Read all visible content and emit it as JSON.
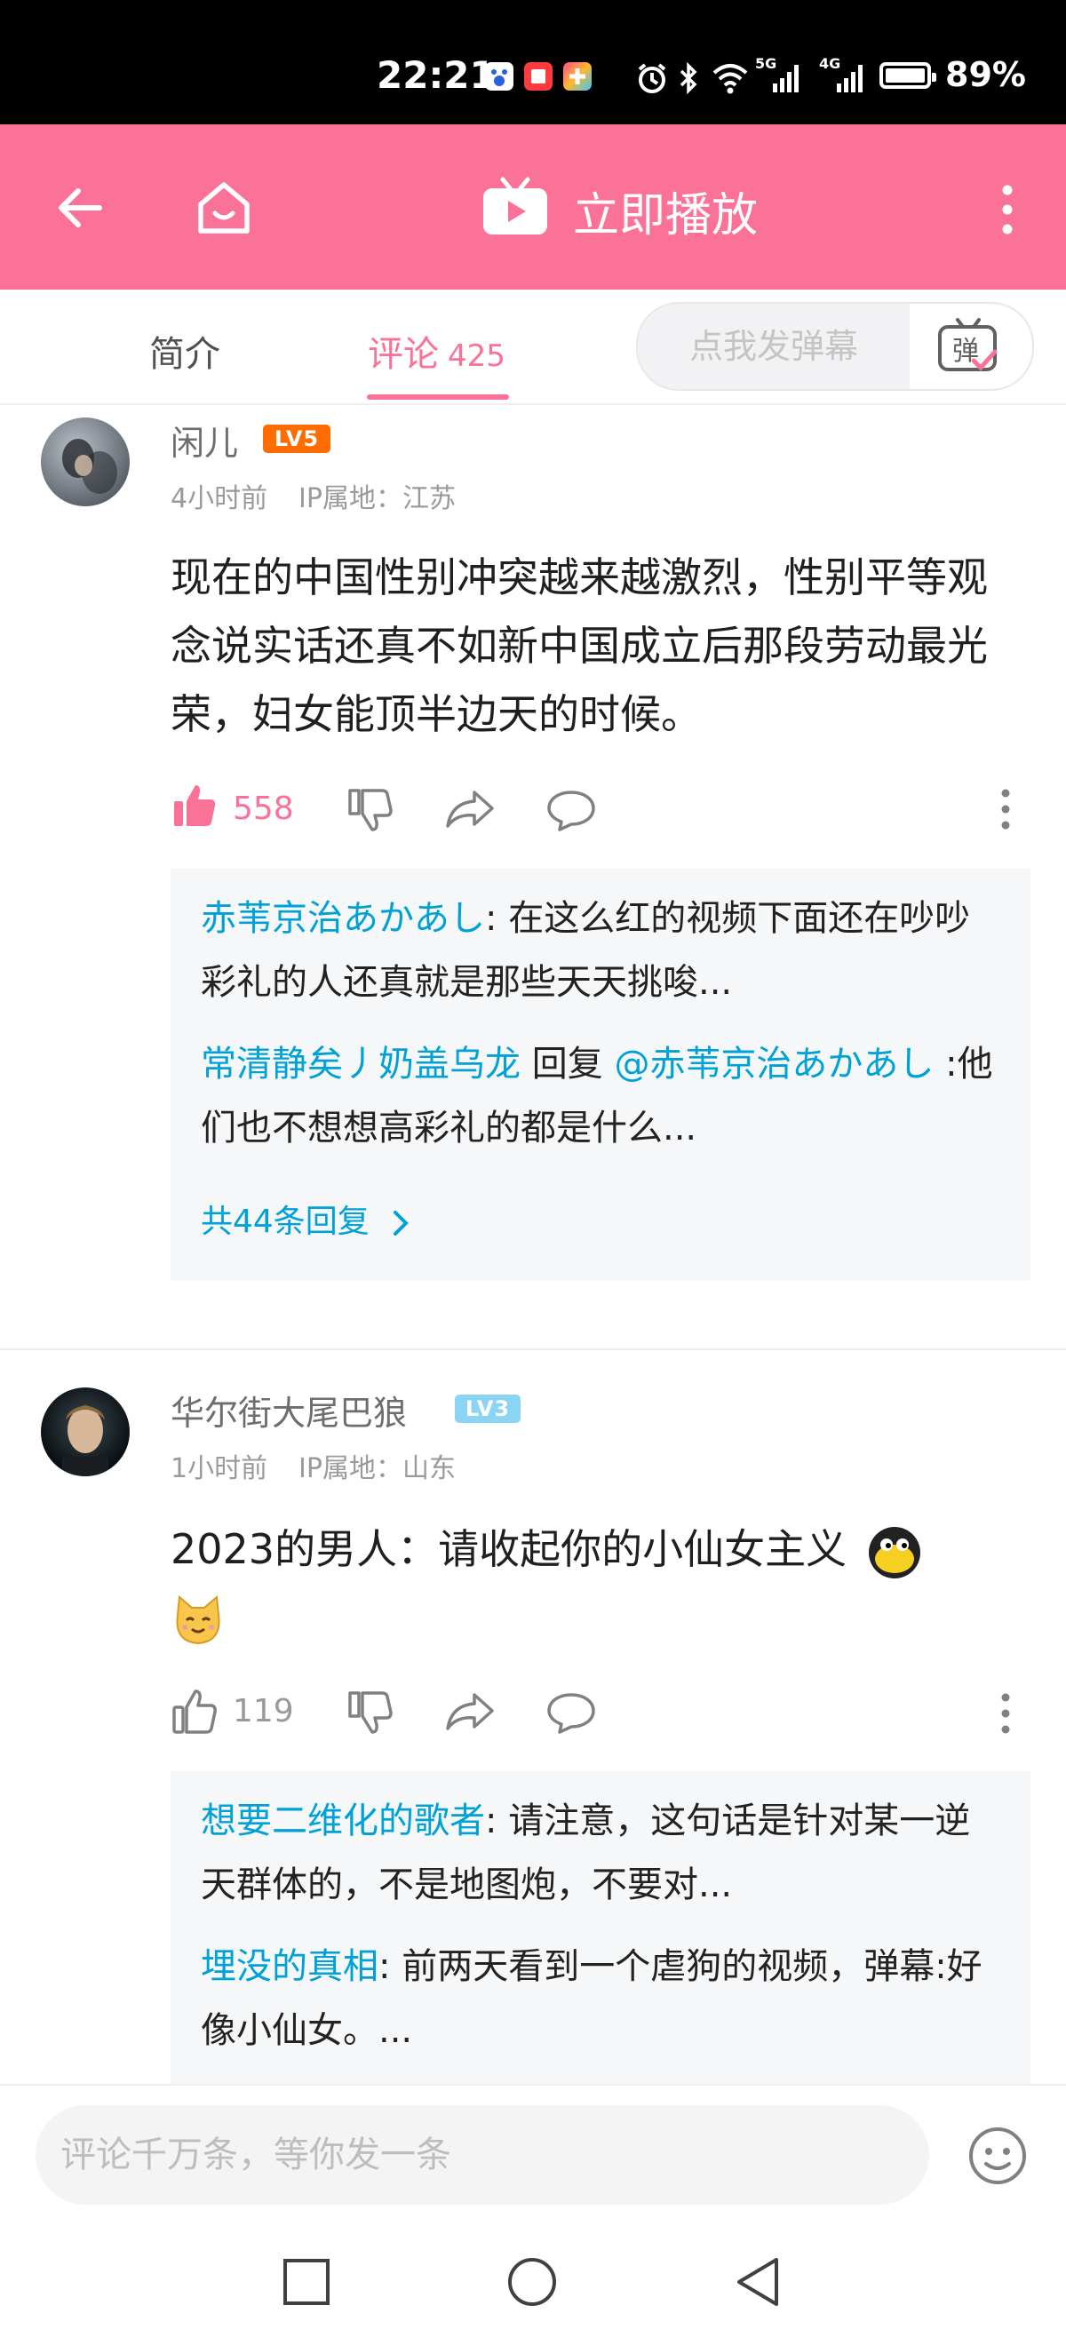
{
  "status_bar": {
    "time": "22:21",
    "battery": "89%",
    "network_1": "5G",
    "network_2": "4G"
  },
  "toolbar": {
    "play_label": "立即播放"
  },
  "tabs": {
    "intro": "简介",
    "comments": "评论",
    "comment_count": "425",
    "danmaku_placeholder": "点我发弹幕",
    "danmaku_icon_text": "弹"
  },
  "comments": [
    {
      "user": "闲儿",
      "level": "LV5",
      "time": "4小时前",
      "location": "IP属地：江苏",
      "text": "现在的中国性别冲突越来越激烈，性别平等观念说实话还真不如新中国成立后那段劳动最光荣，妇女能顶半边天的时候。",
      "likes": "558",
      "replies": [
        {
          "name": "赤苇京治あかあし",
          "text": ": 在这么红的视频下面还在吵吵彩礼的人还真就是那些天天挑唆..."
        },
        {
          "name": "常清静矣丿奶盖乌龙",
          "reply_word": " 回复 ",
          "target": "@赤苇京治あかあし",
          "text": " :他们也不想想高彩礼的都是什么..."
        }
      ],
      "more_replies": "共44条回复"
    },
    {
      "user": "华尔街大尾巴狼",
      "level": "LV3",
      "time": "1小时前",
      "location": "IP属地：山东",
      "text": "2023的男人：请收起你的小仙女主义",
      "likes": "119",
      "replies": [
        {
          "name": "想要二维化的歌者",
          "text": ": 请注意，这句话是针对某一逆天群体的，不是地图炮，不要对..."
        },
        {
          "name": "埋没的真相",
          "text": ": 前两天看到一个虐狗的视频，弹幕:好像小仙女。..."
        }
      ]
    }
  ],
  "input_bar": {
    "placeholder": "评论千万条，等你发一条"
  },
  "colors": {
    "accent": "#fb7299",
    "link": "#00a1d6",
    "lv5": "#ff6c00",
    "lv3": "#8bd4f4"
  }
}
